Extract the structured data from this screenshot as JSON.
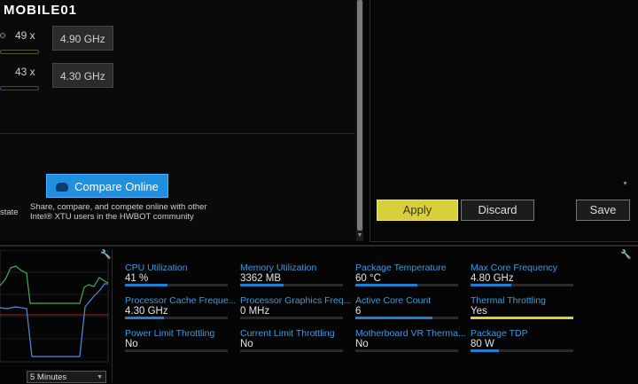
{
  "logo": "MOBILE01",
  "multipliers": [
    {
      "ratio": "49 x",
      "freq": "4.90 GHz",
      "bar_color": "#4b5a2e",
      "fill": 1.0
    },
    {
      "ratio": "43 x",
      "freq": "4.30 GHz",
      "bar_color": "#1e4f86",
      "fill": 1.0
    }
  ],
  "compare": {
    "button_label": "Compare Online",
    "description": "Share, compare, and compete online with other Intel® XTU users in the HWBOT community",
    "state_label": "state"
  },
  "actions": {
    "apply": "Apply",
    "discard": "Discard",
    "save": "Save"
  },
  "graph": {
    "time_range": "5 Minutes"
  },
  "metrics": [
    {
      "label": "CPU Utilization",
      "value": "41 %",
      "fill": 0.41,
      "color": "#1e7fd3"
    },
    {
      "label": "Memory Utilization",
      "value": "3362  MB",
      "fill": 0.42,
      "color": "#1e7fd3"
    },
    {
      "label": "Package Temperature",
      "value": "60 °C",
      "fill": 0.6,
      "color": "#1e7fd3"
    },
    {
      "label": "Max Core Frequency",
      "value": "4.80 GHz",
      "fill": 0.4,
      "color": "#1e7fd3"
    },
    {
      "label": "Processor Cache Freque...",
      "value": "4.30 GHz",
      "fill": 0.38,
      "color": "#1e7fd3"
    },
    {
      "label": "Processor Graphics Freq...",
      "value": "0 MHz",
      "fill": 0.0,
      "color": "#1e7fd3"
    },
    {
      "label": "Active Core Count",
      "value": "6",
      "fill": 0.75,
      "color": "#1e7fd3"
    },
    {
      "label": "Thermal Throttling",
      "value": "Yes",
      "fill": 1.0,
      "color": "#d9cf3a"
    },
    {
      "label": "Power Limit Throttling",
      "value": "No",
      "fill": 0.0,
      "color": "#1e7fd3"
    },
    {
      "label": "Current Limit Throttling",
      "value": "No",
      "fill": 0.0,
      "color": "#1e7fd3"
    },
    {
      "label": "Motherboard VR Therma...",
      "value": "No",
      "fill": 0.0,
      "color": "#1e7fd3"
    },
    {
      "label": "Package TDP",
      "value": "80 W",
      "fill": 0.28,
      "color": "#1e7fd3"
    }
  ]
}
